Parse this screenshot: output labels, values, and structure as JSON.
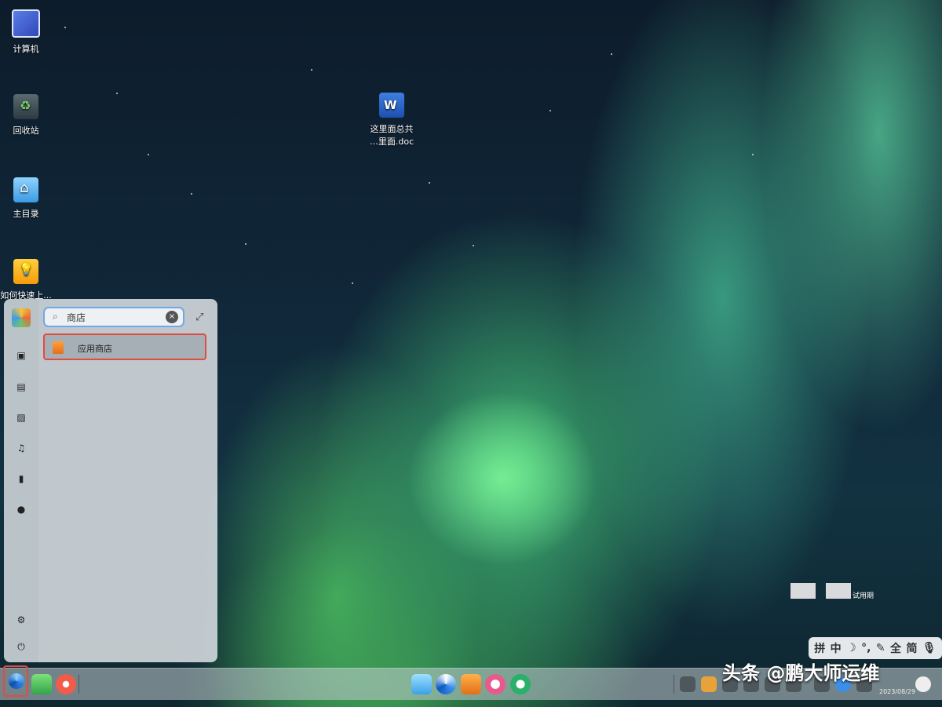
{
  "desktop": {
    "icons": [
      {
        "label": "计算机",
        "icon": "computer-icon"
      },
      {
        "label": "回收站",
        "icon": "trash-icon"
      },
      {
        "label": "主目录",
        "icon": "home-folder-icon"
      },
      {
        "label": "如何快速上...",
        "icon": "uos-guide-icon"
      },
      {
        "label_line1": "这里面总共",
        "label_line2": "…里面.doc",
        "icon": "word-doc-icon"
      }
    ]
  },
  "launcher": {
    "search_value": "商店",
    "result_label": "应用商店",
    "category_icons": [
      "all-apps-icon",
      "document-icon",
      "picture-icon",
      "music-icon",
      "video-icon",
      "download-icon"
    ],
    "bottom_icons": [
      "settings-icon",
      "power-icon"
    ]
  },
  "dock": {
    "left_items": [
      "launcher-icon",
      "multitask-icon",
      "screen-recorder-icon"
    ],
    "center_items": [
      "file-manager-icon",
      "browser-icon",
      "app-store-icon",
      "control-center-icon",
      "uos-icon"
    ]
  },
  "ime": {
    "items": [
      "拼",
      "中",
      "☽",
      "°,",
      "✎",
      "全",
      "简",
      "🎙"
    ]
  },
  "overlay": {
    "watermark": "头条 @鹏大师运维",
    "trial_text": "试用期",
    "date": "2023/08/29"
  },
  "colors": {
    "accent": "#e34b3e",
    "search_border": "#6fa8e8"
  }
}
